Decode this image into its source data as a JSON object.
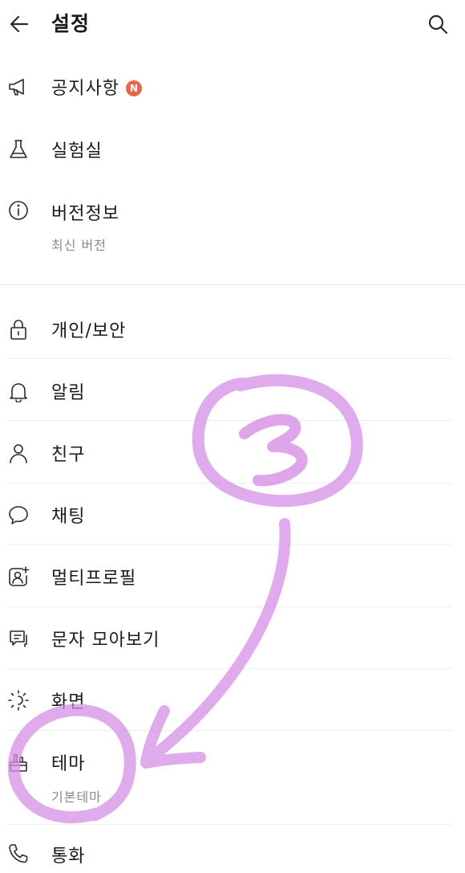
{
  "header": {
    "title": "설정",
    "back_icon": "arrow-left-icon",
    "search_icon": "search-icon"
  },
  "items": [
    {
      "label": "공지사항",
      "icon": "megaphone-icon",
      "badge": "N"
    },
    {
      "label": "실험실",
      "icon": "flask-icon"
    },
    {
      "label": "버전정보",
      "icon": "info-icon",
      "sub": "최신 버전"
    },
    {
      "label": "개인/보안",
      "icon": "lock-icon"
    },
    {
      "label": "알림",
      "icon": "bell-icon"
    },
    {
      "label": "친구",
      "icon": "person-icon"
    },
    {
      "label": "채팅",
      "icon": "chat-bubble-icon"
    },
    {
      "label": "멀티프로필",
      "icon": "profile-plus-icon"
    },
    {
      "label": "문자 모아보기",
      "icon": "message-stack-icon"
    },
    {
      "label": "화면",
      "icon": "brightness-icon"
    },
    {
      "label": "테마",
      "icon": "paint-brush-icon",
      "sub": "기본테마"
    },
    {
      "label": "통화",
      "icon": "phone-icon"
    }
  ],
  "annotation": {
    "step_number": "3",
    "color": "#d68fe6"
  },
  "colors": {
    "badge": "#e5674a",
    "subtext": "#8a8a8a",
    "divider": "#efefef"
  }
}
